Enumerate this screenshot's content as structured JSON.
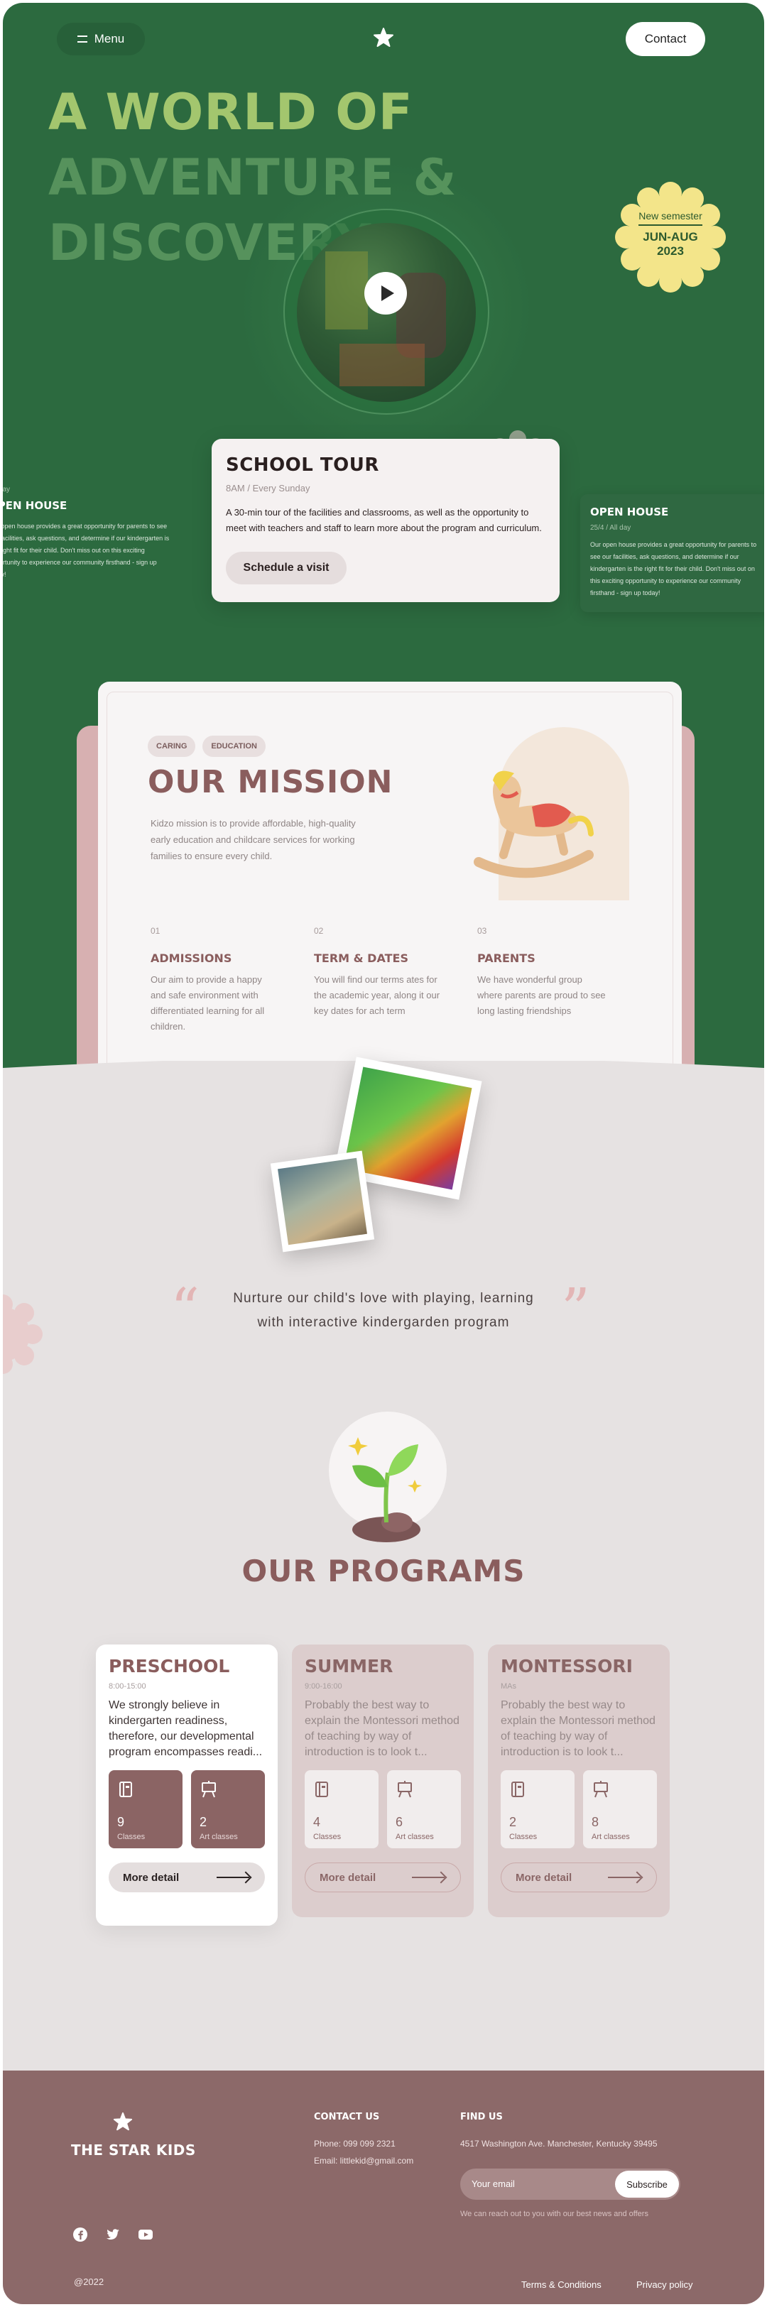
{
  "header": {
    "menu_label": "Menu",
    "contact_label": "Contact"
  },
  "hero": {
    "title_line1": "A WORLD OF",
    "title_line2": "ADVENTURE & DISCOVERY",
    "badge": {
      "line1": "New semester",
      "line2": "JUN-AUG",
      "line3": "2023"
    }
  },
  "events": {
    "left": {
      "meta": "All day",
      "title": "OPEN HOUSE",
      "text": "Our open house provides a great opportunity for parents to see our facilities, ask questions, and determine if our kindergarten is the right fit for their child. Don't miss out on this exciting opportunity to experience our community firsthand - sign up today!"
    },
    "center": {
      "title": "SCHOOL TOUR",
      "meta": "8AM  /  Every Sunday",
      "text": "A 30-min tour of the facilities and classrooms, as well as the opportunity to meet with teachers and staff to learn more about the program and curriculum.",
      "cta": "Schedule a visit"
    },
    "right": {
      "title": "OPEN HOUSE",
      "meta": "25/4  /  All day",
      "text": "Our open house provides a great opportunity for parents to see our facilities, ask questions, and determine if our kindergarten is the right fit for their child. Don't miss out on this exciting opportunity to experience our community firsthand - sign up today!"
    }
  },
  "mission": {
    "tags": [
      "CARING",
      "EDUCATION"
    ],
    "title": "OUR MISSION",
    "description": "Kidzo mission is to provide affordable, high-quality early education and childcare services for working families to ensure every child.",
    "steps": [
      {
        "num": "01",
        "title": "ADMISSIONS",
        "text": "Our aim to provide a happy and safe environment with differentiated learning for all children."
      },
      {
        "num": "02",
        "title": "TERM & DATES",
        "text": "You will find our terms ates for the academic year, along it our key dates for ach term"
      },
      {
        "num": "03",
        "title": "PARENTS",
        "text": "We have wonderful group where parents are proud to see long lasting friendships"
      }
    ]
  },
  "quote": {
    "line1": "Nurture our child's love with playing, learning",
    "line2": "with interactive kindergarden program"
  },
  "programs": {
    "title": "OUR PROGRAMS",
    "items": [
      {
        "name": "PRESCHOOL",
        "time": "8:00-15:00",
        "desc": "We strongly believe in kindergarten readiness, therefore, our developmental program encompasses readi...",
        "classes": "9",
        "classes_label": "Classes",
        "art": "2",
        "art_label": "Art classes",
        "more": "More detail"
      },
      {
        "name": "SUMMER",
        "time": "9:00-16:00",
        "desc": "Probably the best way to explain the Montessori method of teaching by way of introduction is to look t...",
        "classes": "4",
        "classes_label": "Classes",
        "art": "6",
        "art_label": "Art classes",
        "more": "More detail"
      },
      {
        "name": "MONTESSORI",
        "time": "MAs",
        "desc": "Probably the best way to explain the Montessori method of teaching by way of introduction is to look t...",
        "classes": "2",
        "classes_label": "Classes",
        "art": "8",
        "art_label": "Art classes",
        "more": "More detail"
      }
    ]
  },
  "footer": {
    "brand": "THE STAR KIDS",
    "copyright": "@2022",
    "contact_title": "CONTACT US",
    "phone": "Phone: 099 099 2321",
    "email": "Email: littlekid@gmail.com",
    "find_title": "FIND US",
    "address": "4517 Washington Ave. Manchester, Kentucky 39495",
    "email_placeholder": "Your email",
    "subscribe_label": "Subscribe",
    "note": "We can reach out to you with our best news and offers",
    "terms": "Terms & Conditions",
    "privacy": "Privacy policy"
  },
  "colors": {
    "hero_green": "#2c6a3f",
    "accent_mauve": "#8a5d5d",
    "badge_yellow": "#f3e58a",
    "page_bg": "#e6e2e2",
    "footer_bg": "#8c6969"
  }
}
